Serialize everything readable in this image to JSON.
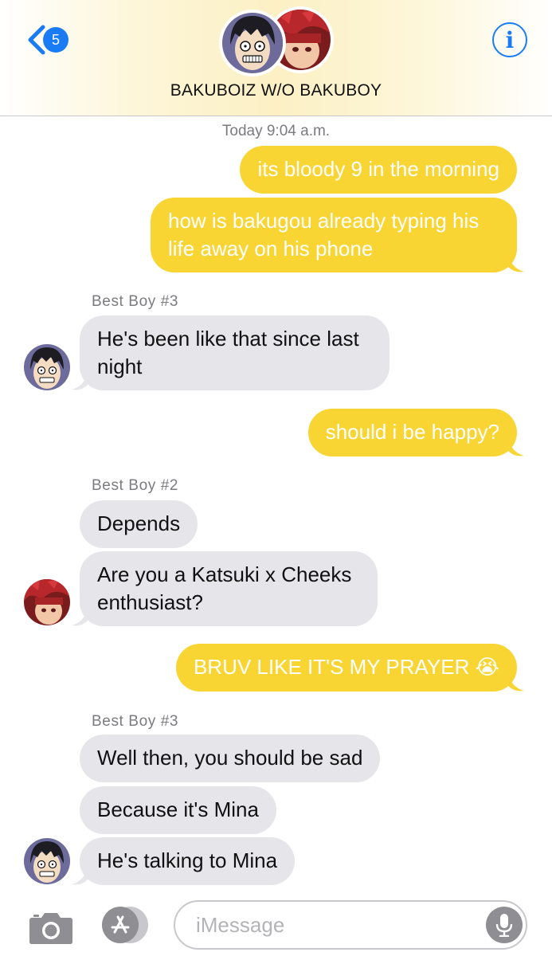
{
  "header": {
    "back_badge_count": "5",
    "group_name": "BAKUBOIZ W/O BAKUBOY",
    "info_label": "i"
  },
  "thread": {
    "timestamp": "Today 9:04 a.m.",
    "messages": [
      {
        "dir": "out",
        "text": "its bloody 9 in the morning"
      },
      {
        "dir": "out",
        "text": "how is bakugou already typing his\nlife away on his phone"
      },
      {
        "dir": "in",
        "sender": "Best Boy #3",
        "text": "He's been like that since last\nnight"
      },
      {
        "dir": "out",
        "text": "should i be happy?"
      },
      {
        "dir": "in",
        "sender": "Best Boy #2",
        "text": "Depends"
      },
      {
        "dir": "in",
        "text": "Are you a Katsuki x Cheeks\nenthusiast?"
      },
      {
        "dir": "out",
        "text": "BRUV LIKE IT'S MY PRAYER 😭"
      },
      {
        "dir": "in",
        "sender": "Best Boy #3",
        "text": "Well then, you should be sad"
      },
      {
        "dir": "in",
        "text": "Because it's Mina"
      },
      {
        "dir": "in",
        "text": "He's talking to Mina"
      }
    ]
  },
  "composer": {
    "placeholder": "iMessage"
  },
  "colors": {
    "accent": "#1a7cf5",
    "outgoing_bubble": "#f9d534",
    "incoming_bubble": "#e5e5ea"
  },
  "icons": [
    "chevron-left-icon",
    "info-icon",
    "camera-icon",
    "app-store-icon",
    "microphone-icon"
  ]
}
